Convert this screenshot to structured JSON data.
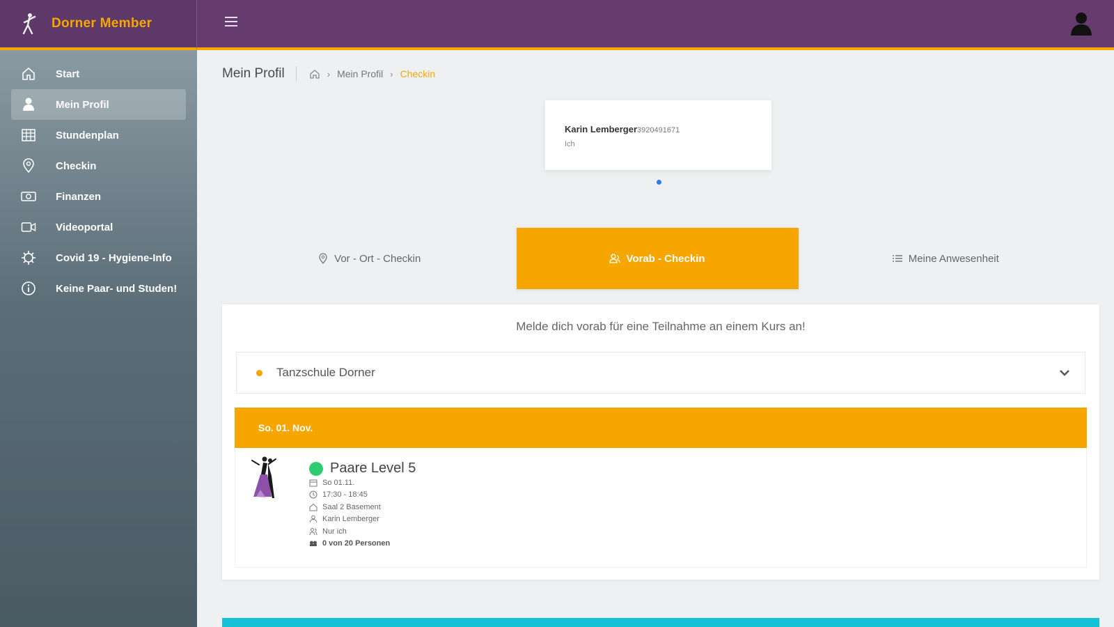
{
  "app": {
    "title": "Dorner Member"
  },
  "colors": {
    "brand_purple": "#663c6e",
    "accent_orange": "#f7a600",
    "status_green": "#2ecc71",
    "strip_cyan": "#16c3d6"
  },
  "sidebar": {
    "items": [
      {
        "label": "Start",
        "icon": "home-icon"
      },
      {
        "label": "Mein Profil",
        "icon": "user-icon",
        "active": true
      },
      {
        "label": "Stundenplan",
        "icon": "grid-icon"
      },
      {
        "label": "Checkin",
        "icon": "location-pin-icon"
      },
      {
        "label": "Finanzen",
        "icon": "money-icon"
      },
      {
        "label": "Videoportal",
        "icon": "video-icon"
      },
      {
        "label": "Covid 19 - Hygiene-Info",
        "icon": "virus-icon"
      },
      {
        "label": "Keine Paar- und Studen!",
        "icon": "info-icon"
      }
    ]
  },
  "breadcrumb": {
    "page_title": "Mein Profil",
    "items": [
      "Mein Profil",
      "Checkin"
    ]
  },
  "member": {
    "name": "Karin Lemberger",
    "id": "3920491671",
    "sub": "Ich"
  },
  "tabs": [
    {
      "label": "Vor - Ort - Checkin",
      "icon": "location-pin-icon"
    },
    {
      "label": "Vorab - Checkin",
      "icon": "user-group-icon",
      "active": true
    },
    {
      "label": "Meine Anwesenheit",
      "icon": "list-icon"
    }
  ],
  "panel": {
    "heading": "Melde dich vorab für eine Teilnahme an einem Kurs an!",
    "school": "Tanzschule Dorner",
    "date": "So. 01. Nov.",
    "course": {
      "title": "Paare Level 5",
      "date": "So 01.11.",
      "time": "17:30 - 18:45",
      "room": "Saal 2 Basement",
      "teacher": "Karin Lemberger",
      "participants": "Nur ich",
      "capacity": "0 von 20 Personen"
    }
  }
}
